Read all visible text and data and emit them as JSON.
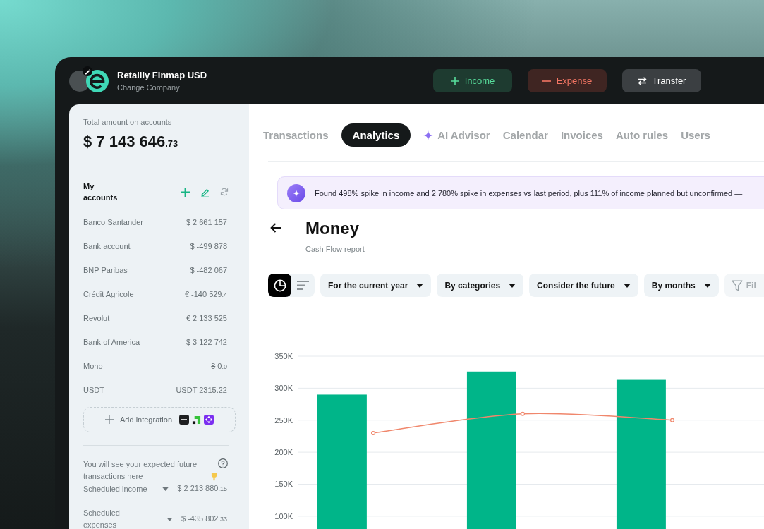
{
  "header": {
    "company": "Retailly Finmap USD",
    "subtitle": "Change Company",
    "actions": [
      {
        "kind": "income",
        "label": "Income"
      },
      {
        "kind": "expense",
        "label": "Expense"
      },
      {
        "kind": "transfer",
        "label": "Transfer"
      }
    ]
  },
  "sidebar": {
    "total_label": "Total amount on accounts",
    "total": {
      "currency": "$",
      "amount": "7 143 646",
      "cents": ".73"
    },
    "accounts_title": "My accounts",
    "accounts": [
      {
        "name": "Banco Santander",
        "currency": "$",
        "amount": "2 661 157"
      },
      {
        "name": "Bank account",
        "currency": "$",
        "amount": "-499 878"
      },
      {
        "name": "BNP Paribas",
        "currency": "$",
        "amount": "-482 067"
      },
      {
        "name": "Crédit Agricole",
        "currency": "€",
        "amount": "-140 529",
        "cents": ".4"
      },
      {
        "name": "Revolut",
        "currency": "€",
        "amount": "2 133 525"
      },
      {
        "name": "Bank of America",
        "currency": "$",
        "amount": "3 122 742"
      },
      {
        "name": "Mono",
        "currency": "₴",
        "amount": "0",
        "cents": ".0"
      },
      {
        "name": "USDT",
        "currency": "USDT",
        "amount": "2315.22"
      }
    ],
    "add_integration": "Add integration",
    "hint": "You will see your expected future transactions here",
    "scheduled": [
      {
        "label": "Scheduled income",
        "currency": "$",
        "amount": "2 213 880",
        "cents": ".15"
      },
      {
        "label": "Scheduled expenses",
        "currency": "$",
        "amount": "-435 802",
        "cents": ".33"
      }
    ]
  },
  "main": {
    "tabs": [
      {
        "kind": "plain",
        "label": "Transactions",
        "selected": false
      },
      {
        "kind": "plain",
        "label": "Analytics",
        "selected": true
      },
      {
        "kind": "ai",
        "label": "AI Advisor",
        "selected": false
      },
      {
        "kind": "plain",
        "label": "Calendar",
        "selected": false
      },
      {
        "kind": "plain",
        "label": "Invoices",
        "selected": false
      },
      {
        "kind": "plain",
        "label": "Auto rules",
        "selected": false
      },
      {
        "kind": "plain",
        "label": "Users",
        "selected": false
      }
    ],
    "insight": "Found 498% spike in income and 2 780% spike in expenses vs last period, plus 111% of income planned but unconfirmed —",
    "report": {
      "title": "Money",
      "subtitle": "Cash Flow report"
    },
    "views": [
      {
        "kind": "chart",
        "selected": true
      },
      {
        "kind": "list",
        "selected": false
      }
    ],
    "filters": [
      {
        "kind": "dropdown",
        "label": "For the current year"
      },
      {
        "kind": "dropdown",
        "label": "By categories"
      },
      {
        "kind": "dropdown",
        "label": "Consider the future"
      },
      {
        "kind": "dropdown",
        "label": "By months"
      },
      {
        "kind": "filter",
        "label": "Fil"
      }
    ],
    "chart_data": {
      "type": "bar",
      "categories": [
        null,
        null,
        null
      ],
      "series": [
        {
          "type": "bar",
          "color": "#00b589",
          "values": [
            290000,
            326000,
            313000
          ]
        },
        {
          "type": "line",
          "color": "#f0876c",
          "marker": "circle",
          "values": [
            230000,
            260000,
            250000
          ]
        }
      ],
      "ylim": [
        80000,
        350000
      ],
      "yticks": [
        {
          "value": 100000,
          "label": "100K"
        },
        {
          "value": 150000,
          "label": "150K"
        },
        {
          "value": 200000,
          "label": "200K"
        },
        {
          "value": 250000,
          "label": "250K"
        },
        {
          "value": 300000,
          "label": "300K"
        },
        {
          "value": 350000,
          "label": "350K"
        }
      ],
      "grid": true
    }
  }
}
